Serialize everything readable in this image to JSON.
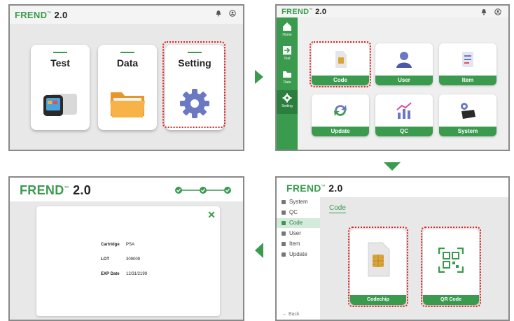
{
  "brand": {
    "name": "FREND",
    "tm": "™",
    "version": "2.0",
    "accent": "#3a9a4e",
    "highlight": "#e02020"
  },
  "screen1": {
    "cards": [
      {
        "title": "Test",
        "icon": "analyzer-device-icon"
      },
      {
        "title": "Data",
        "icon": "folder-icon"
      },
      {
        "title": "Setting",
        "icon": "gear-icon"
      }
    ]
  },
  "screen2": {
    "sidebar": [
      {
        "label": "Home",
        "icon": "home-icon"
      },
      {
        "label": "Test",
        "icon": "test-arrow-icon"
      },
      {
        "label": "Data",
        "icon": "folder-icon"
      },
      {
        "label": "Setting",
        "icon": "gear-icon",
        "active": true
      }
    ],
    "tiles": [
      {
        "label": "Code",
        "icon": "sim-card-icon"
      },
      {
        "label": "User",
        "icon": "user-icon"
      },
      {
        "label": "Item",
        "icon": "clipboard-icon"
      },
      {
        "label": "Update",
        "icon": "refresh-icon"
      },
      {
        "label": "QC",
        "icon": "chart-icon"
      },
      {
        "label": "System",
        "icon": "device-gear-icon"
      }
    ]
  },
  "screen3": {
    "steps_completed": 3,
    "steps_total": 3,
    "fields": [
      {
        "key": "Cartridge",
        "value": "PSA"
      },
      {
        "key": "LOT",
        "value": "309009"
      },
      {
        "key": "EXP Date",
        "value": "12/31/2199"
      }
    ]
  },
  "screen4": {
    "menu": [
      {
        "label": "System"
      },
      {
        "label": "QC"
      },
      {
        "label": "Code",
        "active": true
      },
      {
        "label": "User"
      },
      {
        "label": "Item"
      },
      {
        "label": "Update"
      }
    ],
    "back": "Back",
    "heading": "Code",
    "options": [
      {
        "label": "Codechip",
        "icon": "sim-chip-icon"
      },
      {
        "label": "QR Code",
        "icon": "qr-scan-icon"
      }
    ]
  }
}
